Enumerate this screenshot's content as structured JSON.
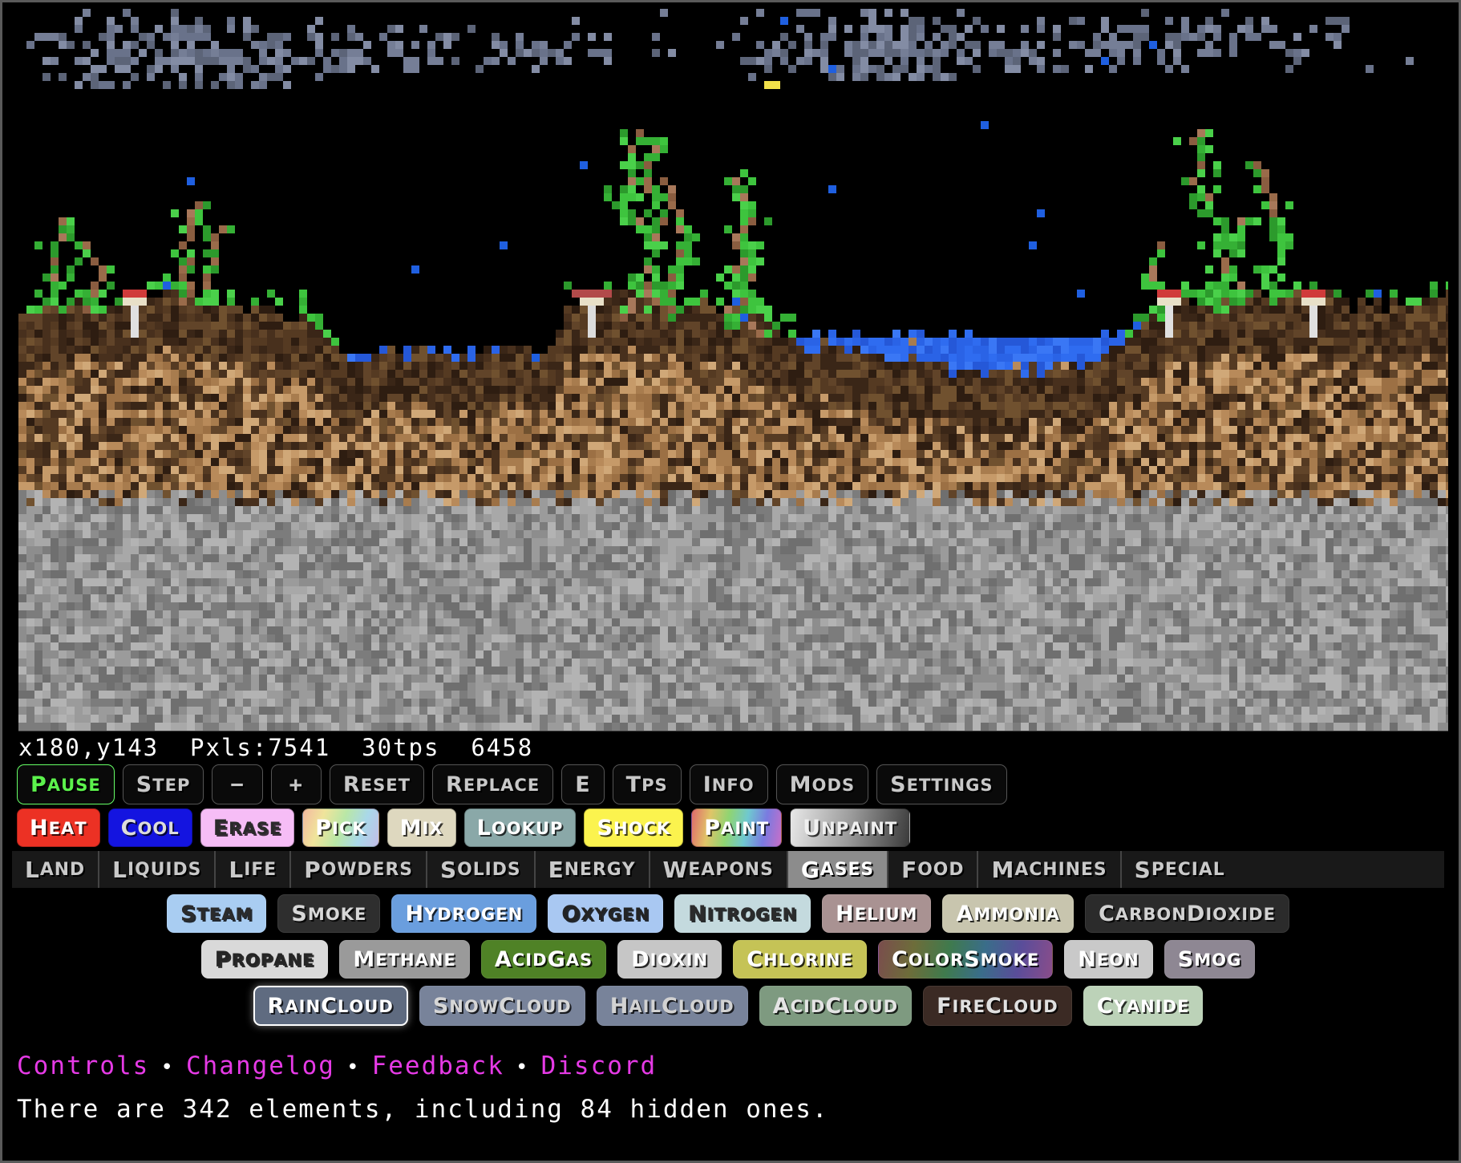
{
  "status": {
    "cursor": "x180,y143",
    "pixels": "Pxls:7541",
    "tps": "30tps",
    "tick": "6458",
    "full_line": "x180,y143  Pxls:7541  30tps  6458"
  },
  "controls": [
    {
      "label": "Pause",
      "name": "pause-button",
      "state": "active"
    },
    {
      "label": "Step",
      "name": "step-button"
    },
    {
      "label": "−",
      "name": "decrease-brush-button"
    },
    {
      "label": "+",
      "name": "increase-brush-button"
    },
    {
      "label": "Reset",
      "name": "reset-button"
    },
    {
      "label": "Replace",
      "name": "replace-button"
    },
    {
      "label": "E",
      "name": "e-button"
    },
    {
      "label": "Tps",
      "name": "tps-button"
    },
    {
      "label": "Info",
      "name": "info-button"
    },
    {
      "label": "Mods",
      "name": "mods-button"
    },
    {
      "label": "Settings",
      "name": "settings-button"
    }
  ],
  "tools": [
    {
      "label": "Heat",
      "name": "heat-tool",
      "bg": "#ec3124",
      "fg": "#ffffff"
    },
    {
      "label": "Cool",
      "name": "cool-tool",
      "bg": "#1414e0",
      "fg": "#dcdcdc"
    },
    {
      "label": "Erase",
      "name": "erase-tool",
      "bg": "#f6bdf6",
      "fg": "#2a2a2a"
    },
    {
      "label": "Pick",
      "name": "pick-tool",
      "bg": "linear-gradient(110deg,#f3b9a0,#f0e49b,#b9e7a6,#a9d8e9,#c3bde8)",
      "fg": "#ffffff"
    },
    {
      "label": "Mix",
      "name": "mix-tool",
      "bg": "#ded8bf",
      "fg": "#ffffff"
    },
    {
      "label": "Lookup",
      "name": "lookup-tool",
      "bg": "#8aa8a8",
      "fg": "#ffffff"
    },
    {
      "label": "Shock",
      "name": "shock-tool",
      "bg": "#fbf34e",
      "fg": "#ffffff"
    },
    {
      "label": "Paint",
      "name": "paint-tool",
      "bg": "linear-gradient(100deg,#e06a6a,#e0c468,#8fd472,#6fc8d0,#7a7ae0,#c86fc8)",
      "fg": "#ffffff"
    },
    {
      "label": "Unpaint",
      "name": "unpaint-tool",
      "bg": "linear-gradient(100deg,#e8e8e8,#9a9a9a,#3a3a3a)",
      "fg": "#f0f0f0"
    }
  ],
  "categories": [
    {
      "label": "Land",
      "selected": false
    },
    {
      "label": "Liquids",
      "selected": false
    },
    {
      "label": "Life",
      "selected": false
    },
    {
      "label": "Powders",
      "selected": false
    },
    {
      "label": "Solids",
      "selected": false
    },
    {
      "label": "Energy",
      "selected": false
    },
    {
      "label": "Weapons",
      "selected": false
    },
    {
      "label": "Gases",
      "selected": true
    },
    {
      "label": "Food",
      "selected": false
    },
    {
      "label": "Machines",
      "selected": false
    },
    {
      "label": "Special",
      "selected": false
    }
  ],
  "elements": [
    [
      {
        "label": "Steam",
        "bg": "#a9cdf2",
        "fg": "#2b2b2b",
        "selected": false
      },
      {
        "label": "Smoke",
        "bg": "#2e2e2e",
        "fg": "#d8d8d8",
        "selected": false
      },
      {
        "label": "Hydrogen",
        "bg": "#6a9ede",
        "fg": "#ffffff",
        "selected": false
      },
      {
        "label": "Oxygen",
        "bg": "#a9c8f2",
        "fg": "#232323",
        "selected": false
      },
      {
        "label": "Nitrogen",
        "bg": "#c4dade",
        "fg": "#2b2b2b",
        "selected": false
      },
      {
        "label": "Helium",
        "bg": "#a99292",
        "fg": "#ffffff",
        "selected": false
      },
      {
        "label": "Ammonia",
        "bg": "#c8c5ae",
        "fg": "#ffffff",
        "selected": false
      },
      {
        "label": "CarbonDioxide",
        "bg": "#2b2b2b",
        "fg": "#d2d2d2",
        "selected": false
      }
    ],
    [
      {
        "label": "Propane",
        "bg": "#d9d9d9",
        "fg": "#252525",
        "selected": false
      },
      {
        "label": "Methane",
        "bg": "#9a9a9a",
        "fg": "#ffffff",
        "selected": false
      },
      {
        "label": "AcidGas",
        "bg": "#4f8226",
        "fg": "#ffffff",
        "selected": false
      },
      {
        "label": "Dioxin",
        "bg": "#c6c6c6",
        "fg": "#ffffff",
        "selected": false
      },
      {
        "label": "Chlorine",
        "bg": "#c5c356",
        "fg": "#ffffff",
        "selected": false
      },
      {
        "label": "ColorSmoke",
        "bg": "linear-gradient(100deg,#7a4d4d,#6d6d3a,#3f7a4d,#3a6d8a,#5a4d9a,#8a4d8a)",
        "fg": "#ffffff",
        "selected": false
      },
      {
        "label": "Neon",
        "bg": "#c9c9c9",
        "fg": "#ffffff",
        "selected": false
      },
      {
        "label": "Smog",
        "bg": "#8e8793",
        "fg": "#ffffff",
        "selected": false
      }
    ],
    [
      {
        "label": "RainCloud",
        "bg": "#5f6b80",
        "fg": "#ffffff",
        "selected": true
      },
      {
        "label": "SnowCloud",
        "bg": "#78839a",
        "fg": "#d6d6d6",
        "selected": false
      },
      {
        "label": "HailCloud",
        "bg": "#78839a",
        "fg": "#d2d2d2",
        "selected": false
      },
      {
        "label": "AcidCloud",
        "bg": "#7e9a80",
        "fg": "#e4e4e4",
        "selected": false
      },
      {
        "label": "FireCloud",
        "bg": "#3b2a24",
        "fg": "#e0e0e0",
        "selected": false
      },
      {
        "label": "Cyanide",
        "bg": "#bcd2b8",
        "fg": "#ffffff",
        "selected": false
      }
    ]
  ],
  "footer": {
    "links": [
      "Controls",
      "Changelog",
      "Feedback",
      "Discord"
    ],
    "separator": "•",
    "element_count_text": "There are 342 elements, including 84 hidden ones.",
    "link_color": "#e63ae6"
  },
  "scene": {
    "description": "Sandboxels simulation canvas: pixel sky with rain clouds, falling rain drops, plant growth, mushrooms, dirt, sand, water pools and stone bedrock",
    "sky_color": "#000000",
    "cloud_color": "#69728a",
    "water_color": "#2d6bf0",
    "dirt_color": "#4a3423",
    "sand_color": "#c08f5e",
    "plant_color": "#3ec43e",
    "wood_color": "#9a6b4a",
    "stone_color": "#9a9a9a",
    "mushroom_cap_color": "#b24a4a",
    "rain_color": "#1f5fe0"
  }
}
